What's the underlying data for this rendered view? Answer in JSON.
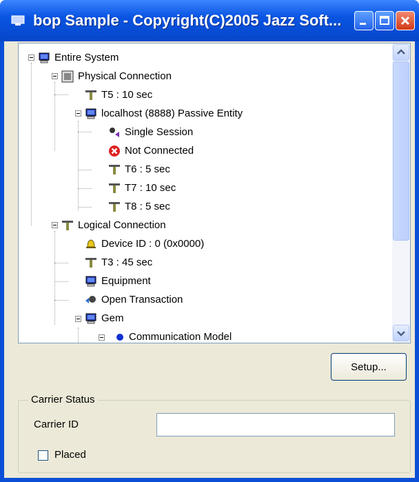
{
  "window": {
    "title": "bop Sample - Copyright(C)2005 Jazz Soft..."
  },
  "tree": {
    "nodes": [
      {
        "label": "Entire System",
        "icon": "computer-icon"
      },
      {
        "label": "Physical Connection",
        "icon": "network-icon"
      },
      {
        "label": "T5 : 10 sec",
        "icon": "timer-icon"
      },
      {
        "label": "localhost (8888) Passive Entity",
        "icon": "computer-icon"
      },
      {
        "label": "Single Session",
        "icon": "session-icon"
      },
      {
        "label": "Not Connected",
        "icon": "error-icon"
      },
      {
        "label": "T6 : 5 sec",
        "icon": "timer-icon"
      },
      {
        "label": "T7 : 10 sec",
        "icon": "timer-icon"
      },
      {
        "label": "T8 : 5 sec",
        "icon": "timer-icon"
      },
      {
        "label": "Logical Connection",
        "icon": "timer-icon"
      },
      {
        "label": "Device ID : 0 (0x0000)",
        "icon": "bell-icon"
      },
      {
        "label": "T3 : 45 sec",
        "icon": "timer-icon"
      },
      {
        "label": "Equipment",
        "icon": "computer-icon"
      },
      {
        "label": "Open Transaction",
        "icon": "transaction-icon"
      },
      {
        "label": "Gem",
        "icon": "computer-icon"
      },
      {
        "label": "Communication Model",
        "icon": "dot-icon"
      }
    ]
  },
  "buttons": {
    "setup": "Setup..."
  },
  "carrier_status": {
    "legend": "Carrier Status",
    "carrier_id_label": "Carrier ID",
    "carrier_id_value": "",
    "placed_label": "Placed",
    "placed_checked": false
  },
  "colors": {
    "titlebar": "#0a55e3",
    "client": "#ece9d8",
    "error": "#e02020"
  }
}
